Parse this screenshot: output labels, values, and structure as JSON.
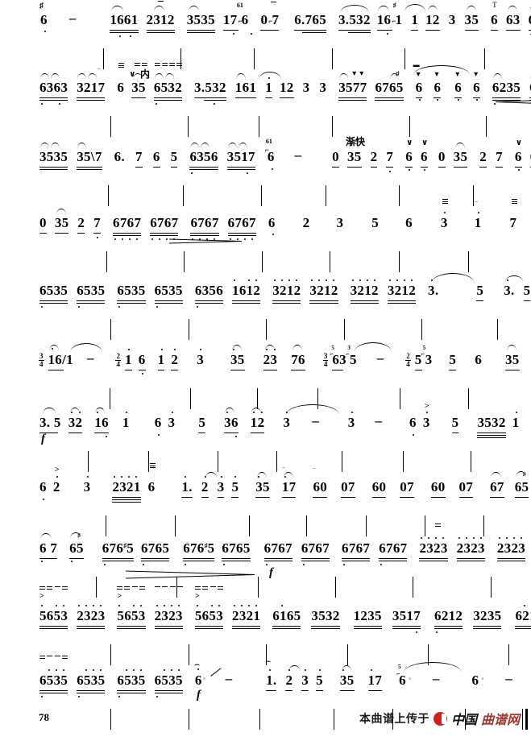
{
  "document": {
    "type": "jianpu-numbered-musical-notation",
    "page_number": "78",
    "language": "zh"
  },
  "footer": {
    "credit_text": "本曲谱上传于",
    "logo_black": "中国",
    "logo_red": "曲谱网",
    "logo_icon": "circle-logo-icon",
    "logo_color_red": "#cc2222",
    "logo_color_brown": "#9b3a2e"
  },
  "annotations": {
    "tempo_faster": "渐快",
    "inner_string": "内",
    "dynamic_forte": "f",
    "trill": "T",
    "accent": ">"
  },
  "systems": [
    {
      "index": 1,
      "measures": [
        {
          "notes": "6",
          "kind": "pickup"
        },
        {
          "notes": "-",
          "kind": "dash"
        },
        {
          "notes": "1661 2312"
        },
        {
          "notes": "3535 17 6"
        },
        {
          "notes": "0 7  6.765"
        },
        {
          "notes": "3.532 16 1"
        },
        {
          "notes": "1 12 3 35"
        },
        {
          "notes": "6 63 6335"
        }
      ],
      "raw": "6 - | 1661 2312 | 3535 17 6 | 0 7 6.765 | 3.532 16 1 | 1 12 3 35 | 6 63 6335 |"
    },
    {
      "index": 2,
      "measures": [
        {
          "notes": "6363 3217"
        },
        {
          "notes": "6 35 6532"
        },
        {
          "notes": "3.532 161"
        },
        {
          "notes": "1 12 3 3"
        },
        {
          "notes": "3577 676 5"
        },
        {
          "notes": "6 6 6 6"
        },
        {
          "notes": "6235 6235"
        }
      ],
      "raw": "6363 3217 | 6 35 6532 | 3.532 161 | 1 12 3 3 | 3577 676 5 | 6 6 6 6 | 6235 6235 |"
    },
    {
      "index": 3,
      "measures": [
        {
          "notes": "3535 35\\7"
        },
        {
          "notes": "6. 7 6 5"
        },
        {
          "notes": "6356 3517"
        },
        {
          "notes": "6 -"
        },
        {
          "notes": "0 35 2 7"
        },
        {
          "notes": "6 6 0 35"
        },
        {
          "notes": "2 7 6 6"
        }
      ],
      "raw": "3535 35\\7 | 6. 7 6 5 | 6356 3517 | 6 - | 0 35 2 7 | 6 6 0 35 | 2 7 6 6 |"
    },
    {
      "index": 4,
      "measures": [
        {
          "notes": "0 35 2 7"
        },
        {
          "notes": "6767 6767"
        },
        {
          "notes": "6767 6767"
        },
        {
          "notes": "6 2"
        },
        {
          "notes": "3 5"
        },
        {
          "notes": "6 3"
        },
        {
          "notes": "1 7"
        }
      ],
      "raw": "0 35 2 7 | 6767 6767 | 6767 6767 | 6 2 | 3 5 | 6 3 | 1 7 |"
    },
    {
      "index": 5,
      "measures": [
        {
          "notes": "6535 6535"
        },
        {
          "notes": "6535 6535"
        },
        {
          "notes": "6356 1612"
        },
        {
          "notes": "3212 3212"
        },
        {
          "notes": "3212 3212"
        },
        {
          "notes": "3.  5"
        },
        {
          "notes": "3. 5 3 2"
        }
      ],
      "raw": "6535 6535 | 6535 6535 | 6356 1612 | 3212 3212 | 3212 3212 | 3. 5 | 3. 5 3 2 |"
    },
    {
      "index": 6,
      "time_signatures": [
        "3/4",
        "2/4",
        "3/4",
        "2/4"
      ],
      "measures": [
        {
          "notes": "16/1 -",
          "time": "3/4"
        },
        {
          "notes": "1 6 1 2",
          "time": "2/4"
        },
        {
          "notes": "3   35"
        },
        {
          "notes": "2 3 7 6"
        },
        {
          "notes": "63 5 -",
          "time": "3/4"
        },
        {
          "notes": "5 3 5",
          "time": "2/4"
        },
        {
          "notes": "6 35"
        }
      ],
      "raw": "3/4 16/1 - | 2/4 1 6 1 2 | 3 35 | 2 3 7 6 | 3/4 63 5 - | 2/4 5 3 5 | 6 35 |"
    },
    {
      "index": 7,
      "dynamic": "f",
      "measures": [
        {
          "notes": "3. 5 3 2"
        },
        {
          "notes": "16 1"
        },
        {
          "notes": "63  5"
        },
        {
          "notes": "36 12"
        },
        {
          "notes": "3  -  3  -"
        },
        {
          "notes": "63  5"
        },
        {
          "notes": "3532 1"
        }
      ],
      "raw": "3. 5 3 2 | 16 1 | 63 5 | 36 12 | 3 - 3 - | 63 5 | 3532 1 |"
    },
    {
      "index": 8,
      "measures": [
        {
          "notes": "6 2  3"
        },
        {
          "notes": "2321 6"
        },
        {
          "notes": "1. 2 3 5"
        },
        {
          "notes": "35 17"
        },
        {
          "notes": "60 07"
        },
        {
          "notes": "60 07"
        },
        {
          "notes": "60 07"
        },
        {
          "notes": "67 6 5"
        }
      ],
      "raw": "6 2 3 | 2321 6 | 1. 2 3 5 | 35 17 | 60 07 | 60 07 | 60 07 | 67 6 5 |"
    },
    {
      "index": 9,
      "dynamic": "f",
      "measures": [
        {
          "notes": "6 7  6 5"
        },
        {
          "notes": "676 5 6765"
        },
        {
          "notes": "676 5 6765"
        },
        {
          "notes": "6767 6767"
        },
        {
          "notes": "6767 6767"
        },
        {
          "notes": "2323 2323"
        },
        {
          "notes": "2323 2323"
        }
      ],
      "raw": "6 7 6 5 | 676#5 6765 | 676#5 6765 | 6767 6767 | 6767 6767 | 2323 2323 | 2323 2323 |"
    },
    {
      "index": 10,
      "measures": [
        {
          "notes": "5653 2323"
        },
        {
          "notes": "5653 2323"
        },
        {
          "notes": "5653 2321"
        },
        {
          "notes": "6165 3532"
        },
        {
          "notes": "1235 3517"
        },
        {
          "notes": "6212 3235"
        },
        {
          "notes": "6212 3235"
        }
      ],
      "raw": "5653 2323 | 5653 2323 | 5653 2321 | 6165 3532 | 1235 3517 | 6212 3235 | 6212 3235 |"
    },
    {
      "index": 11,
      "dynamic": "f",
      "measures": [
        {
          "notes": "6535 6535"
        },
        {
          "notes": "6535 6535"
        },
        {
          "notes": "6  -"
        },
        {
          "notes": "1. 2 3 5"
        },
        {
          "notes": "3 5 1 7"
        },
        {
          "notes": "6  -"
        },
        {
          "notes": "6  -"
        }
      ],
      "raw": "6535 6535 | 6535 6535 | 6 - | 1. 2 3 5 | 3 5 1 7 | 6 - | 6 - ||"
    }
  ]
}
